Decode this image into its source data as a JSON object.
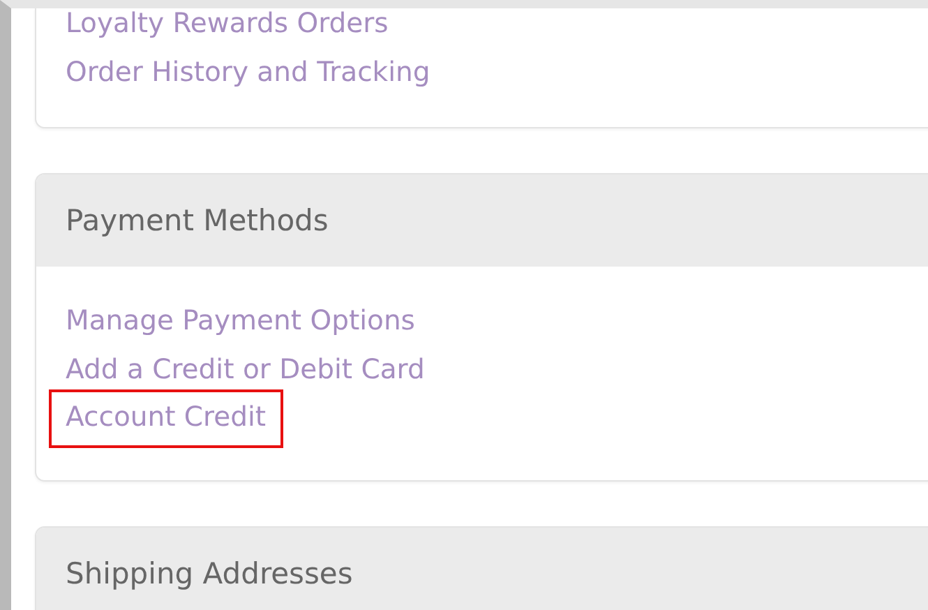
{
  "sections": [
    {
      "links": [
        {
          "label": "Loyalty Rewards Orders",
          "highlighted": false
        },
        {
          "label": "Order History and Tracking",
          "highlighted": false
        }
      ]
    },
    {
      "title": "Payment Methods",
      "links": [
        {
          "label": "Manage Payment Options",
          "highlighted": false
        },
        {
          "label": "Add a Credit or Debit Card",
          "highlighted": false
        },
        {
          "label": "Account Credit",
          "highlighted": true
        }
      ]
    },
    {
      "title": "Shipping Addresses"
    }
  ]
}
